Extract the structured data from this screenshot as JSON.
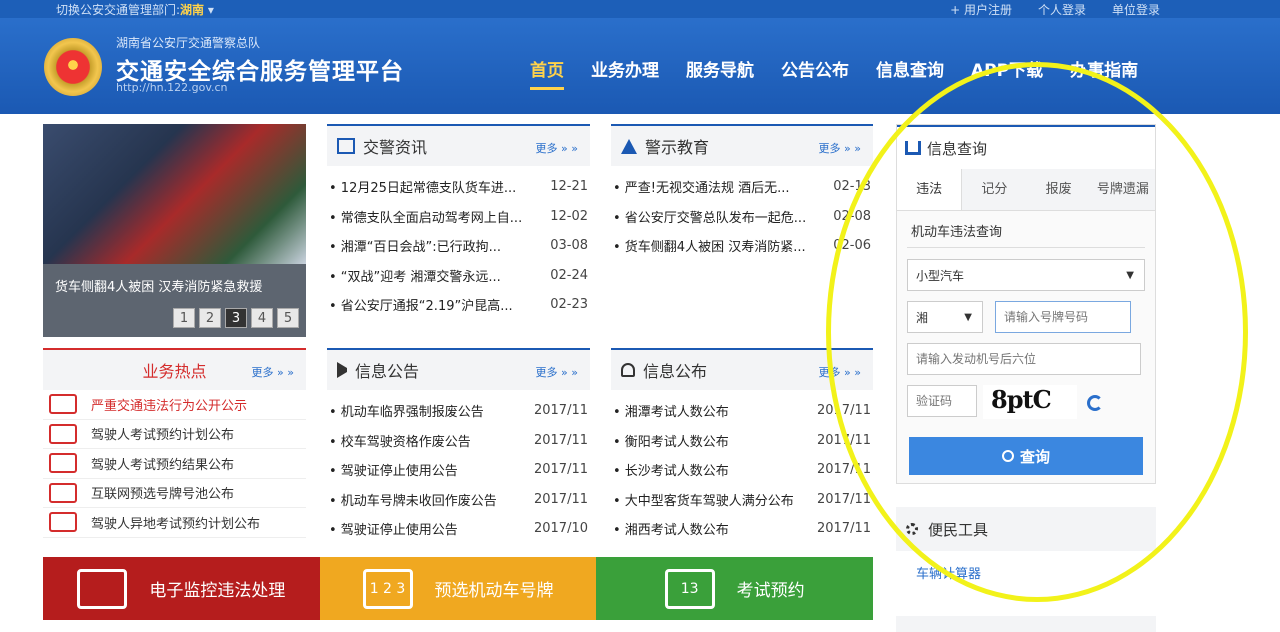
{
  "topbar": {
    "province_prefix": "切换公安交通管理部门:",
    "province": "湖南",
    "links": [
      "+ 用户注册",
      "个人登录",
      "单位登录"
    ]
  },
  "header": {
    "org": "湖南省公安厅交通警察总队",
    "title": "交通安全综合服务管理平台",
    "url": "http://hn.122.gov.cn"
  },
  "nav": [
    "首页",
    "业务办理",
    "服务导航",
    "公告公布",
    "信息查询",
    "APP下载",
    "办事指南"
  ],
  "slide": {
    "caption": "货车侧翻4人被困 汉寿消防紧急救援",
    "pages": [
      "1",
      "2",
      "3",
      "4",
      "5"
    ],
    "active": 3
  },
  "news": {
    "title": "交警资讯",
    "more": "更多 » »",
    "items": [
      {
        "text": "• 12月25日起常德支队货车进...",
        "date": "12-21"
      },
      {
        "text": "• 常德支队全面启动驾考网上自...",
        "date": "12-02"
      },
      {
        "text": "• 湘潭“百日会战”:已行政拘...",
        "date": "03-08"
      },
      {
        "text": "• “双战”迎考 湘潭交警永远...",
        "date": "02-24"
      },
      {
        "text": "• 省公安厅通报“2.19”沪昆高...",
        "date": "02-23"
      }
    ]
  },
  "warn": {
    "title": "警示教育",
    "more": "更多 » »",
    "items": [
      {
        "text": "• 严查!无视交通法规 酒后无...",
        "date": "02-13"
      },
      {
        "text": "• 省公安厅交警总队发布一起危...",
        "date": "02-08"
      },
      {
        "text": "• 货车侧翻4人被困 汉寿消防紧...",
        "date": "02-06"
      }
    ]
  },
  "hot": {
    "title": "业务热点",
    "more": "更多 » »",
    "items": [
      "严重交通违法行为公开公示",
      "驾驶人考试预约计划公布",
      "驾驶人考试预约结果公布",
      "互联网预选号牌号池公布",
      "驾驶人异地考试预约计划公布"
    ]
  },
  "notice": {
    "title": "信息公告",
    "more": "更多 » »",
    "items": [
      {
        "text": "• 机动车临界强制报废公告",
        "date": "2017/11"
      },
      {
        "text": "• 校车驾驶资格作废公告",
        "date": "2017/11"
      },
      {
        "text": "• 驾驶证停止使用公告",
        "date": "2017/11"
      },
      {
        "text": "• 机动车号牌未收回作废公告",
        "date": "2017/11"
      },
      {
        "text": "• 驾驶证停止使用公告",
        "date": "2017/10"
      }
    ]
  },
  "publish": {
    "title": "信息公布",
    "more": "更多 » »",
    "items": [
      {
        "text": "• 湘潭考试人数公布",
        "date": "2017/11"
      },
      {
        "text": "• 衡阳考试人数公布",
        "date": "2017/11"
      },
      {
        "text": "• 长沙考试人数公布",
        "date": "2017/11"
      },
      {
        "text": "• 大中型客货车驾驶人满分公布",
        "date": "2017/11"
      },
      {
        "text": "• 湘西考试人数公布",
        "date": "2017/11"
      }
    ]
  },
  "tiles": [
    {
      "label": "电子监控违法处理",
      "color": "#b51d1d"
    },
    {
      "label": "预选机动车号牌",
      "color": "#f0a820"
    },
    {
      "label": "考试预约",
      "color": "#3aa03a",
      "day": "13"
    }
  ],
  "tile2_nums": "1 2 3",
  "query": {
    "title": "信息查询",
    "tabs": [
      "违法",
      "记分",
      "报废",
      "号牌遗漏"
    ],
    "subtitle": "机动车违法查询",
    "vehicle_type": "小型汽车",
    "plate_prefix": "湘",
    "plate_placeholder": "请输入号牌号码",
    "vin_placeholder": "请输入发动机号后六位",
    "captcha_placeholder": "验证码",
    "captcha_text": "8ptC",
    "button": "查询"
  },
  "tools": {
    "title": "便民工具",
    "item": "车辆计算器"
  }
}
